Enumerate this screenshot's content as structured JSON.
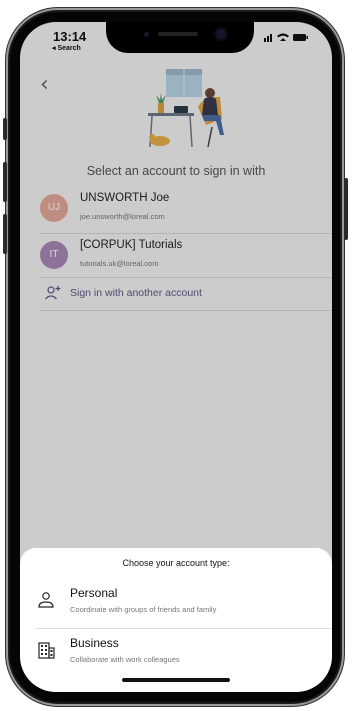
{
  "status_bar": {
    "time": "13:14",
    "back_label": "◂ Search"
  },
  "header": {
    "title": "Select an account to sign in with"
  },
  "accounts": [
    {
      "initials": "UJ",
      "name": "UNSWORTH Joe",
      "email": "joe.unsworth@loreal.com",
      "avatar_color": "#e3a79a"
    },
    {
      "initials": "IT",
      "name": "[CORPUK] Tutorials",
      "email": "tutorials.uk@loreal.com",
      "avatar_color": "#a889b8"
    }
  ],
  "sign_in_other": {
    "label": "Sign in with another account"
  },
  "sheet": {
    "title": "Choose your account type:",
    "options": [
      {
        "label": "Personal",
        "description": "Coordinate with groups of friends and family",
        "icon": "person-icon"
      },
      {
        "label": "Business",
        "description": "Collaborate with work colleagues",
        "icon": "building-icon"
      }
    ]
  }
}
